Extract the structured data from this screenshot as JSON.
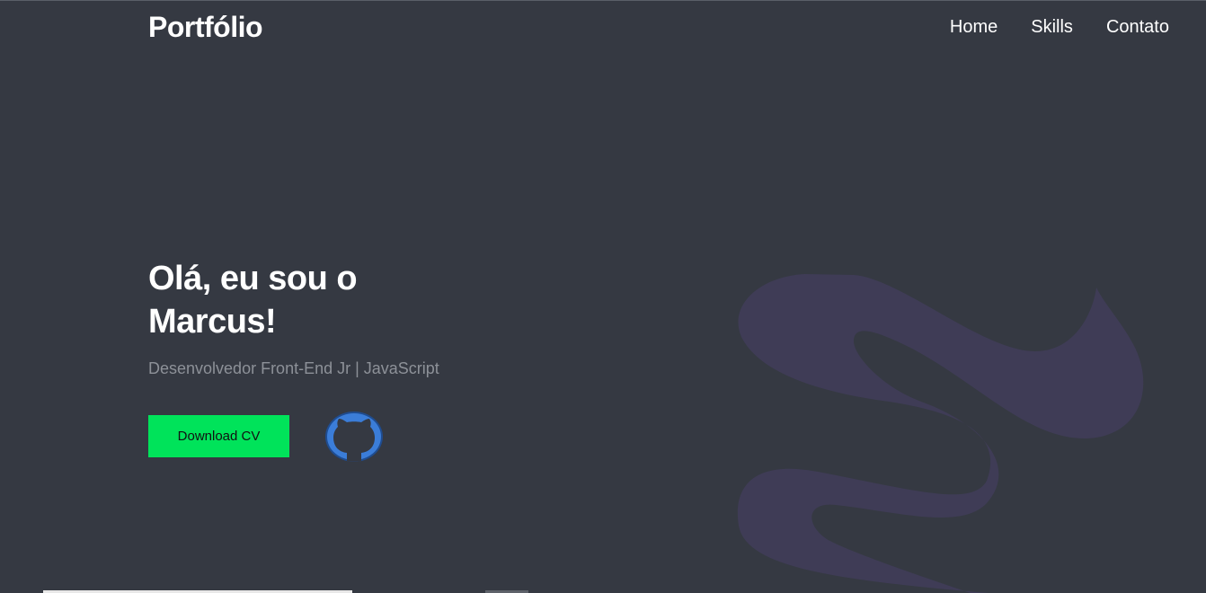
{
  "header": {
    "brand": "Portfólio",
    "nav": [
      {
        "label": "Home"
      },
      {
        "label": "Skills"
      },
      {
        "label": "Contato"
      }
    ]
  },
  "hero": {
    "title_line1": "Olá, eu sou o",
    "title_line2": "Marcus!",
    "subtitle": "Desenvolvedor Front-End Jr | JavaScript",
    "cv_button_label": "Download CV",
    "github_icon": "github-icon"
  },
  "colors": {
    "background": "#353942",
    "accent_green": "#00e35a",
    "decor_shape": "#3f3c56",
    "github_blue": "#3b7dd8",
    "subtitle_text": "#8d9198"
  }
}
